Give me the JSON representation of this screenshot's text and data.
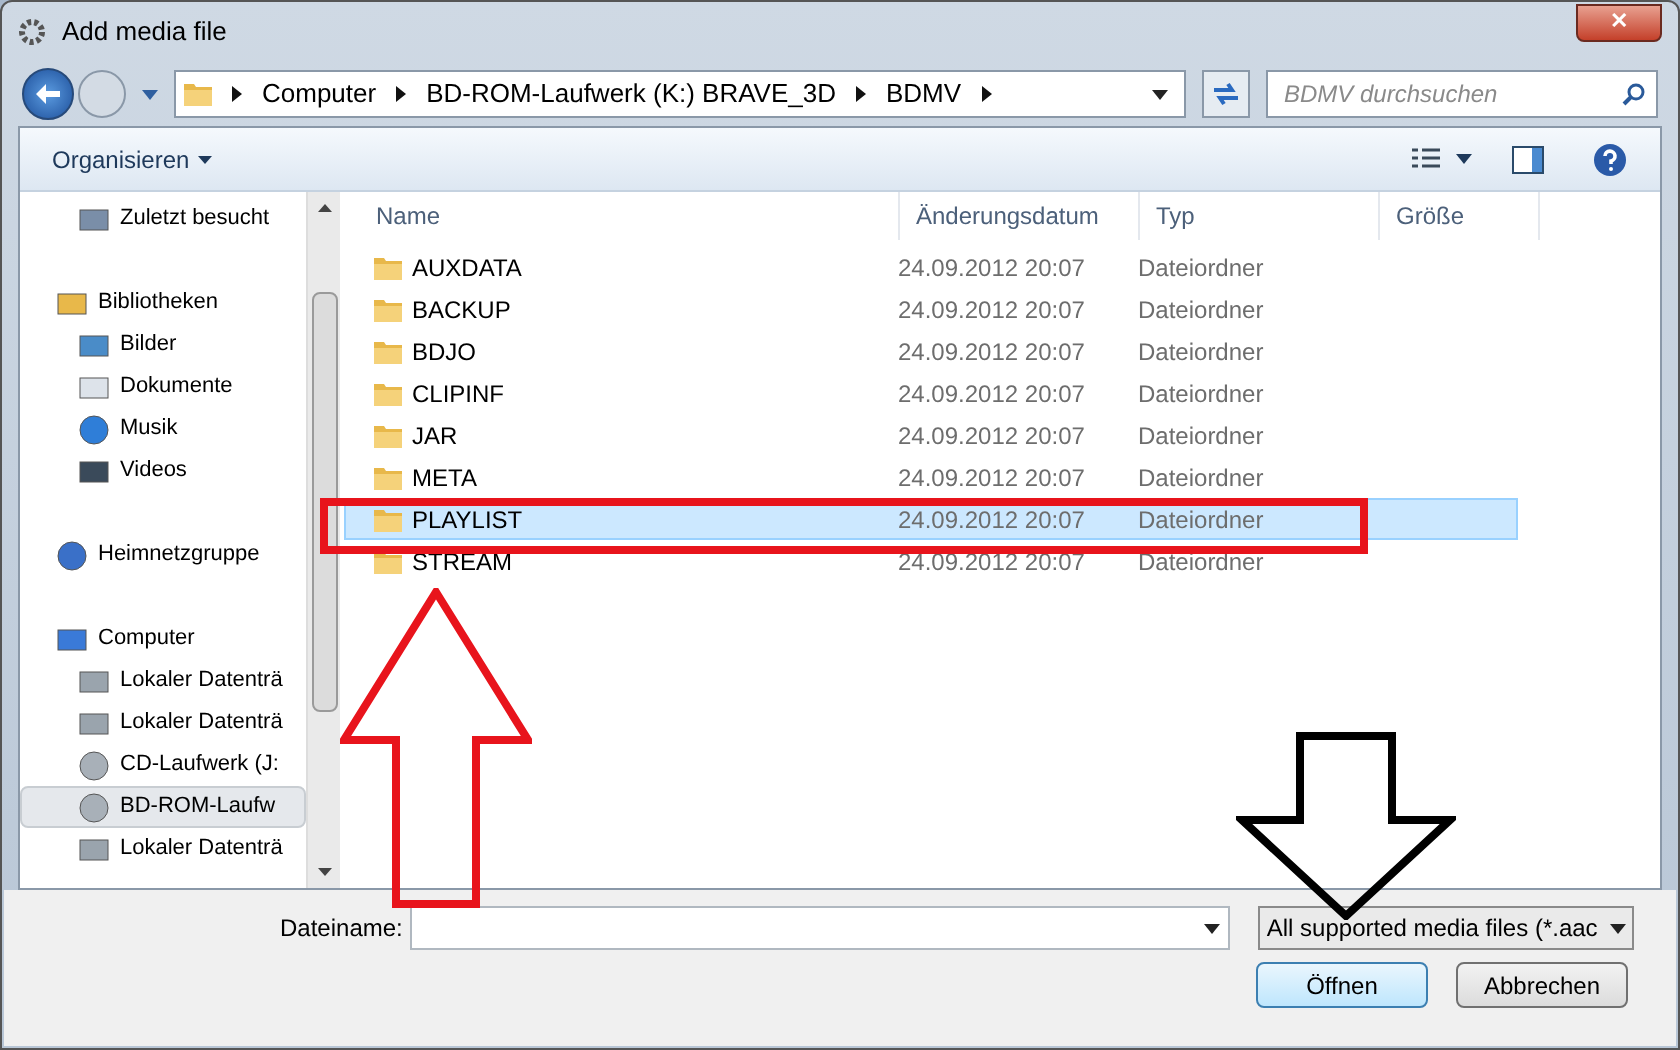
{
  "window": {
    "title": "Add media file",
    "close": "✕"
  },
  "address": {
    "crumbs": [
      "Computer",
      "BD-ROM-Laufwerk (K:) BRAVE_3D",
      "BDMV"
    ],
    "search_placeholder": "BDMV durchsuchen"
  },
  "toolbar": {
    "organize": "Organisieren"
  },
  "sidebar": {
    "groups": [
      {
        "children": [
          {
            "label": "Zuletzt besucht",
            "kind": "recent",
            "selected": false
          }
        ]
      },
      {
        "label": "Bibliotheken",
        "kind": "library",
        "selected": false,
        "children": [
          {
            "label": "Bilder",
            "kind": "pictures",
            "selected": false
          },
          {
            "label": "Dokumente",
            "kind": "documents",
            "selected": false
          },
          {
            "label": "Musik",
            "kind": "music",
            "selected": false
          },
          {
            "label": "Videos",
            "kind": "videos",
            "selected": false
          }
        ]
      },
      {
        "label": "Heimnetzgruppe",
        "kind": "network",
        "selected": false
      },
      {
        "label": "Computer",
        "kind": "computer",
        "selected": false,
        "children": [
          {
            "label": "Lokaler Datenträ",
            "kind": "drive",
            "selected": false
          },
          {
            "label": "Lokaler Datenträ",
            "kind": "drive",
            "selected": false
          },
          {
            "label": "CD-Laufwerk (J:",
            "kind": "cd",
            "selected": false
          },
          {
            "label": "BD-ROM-Laufw",
            "kind": "cd",
            "selected": true
          },
          {
            "label": "Lokaler Datenträ",
            "kind": "drive",
            "selected": false
          }
        ]
      }
    ]
  },
  "table": {
    "columns": [
      "Name",
      "Änderungsdatum",
      "Typ",
      "Größe"
    ],
    "rows": [
      {
        "name": "AUXDATA",
        "date": "24.09.2012 20:07",
        "type": "Dateiordner",
        "selected": false
      },
      {
        "name": "BACKUP",
        "date": "24.09.2012 20:07",
        "type": "Dateiordner",
        "selected": false
      },
      {
        "name": "BDJO",
        "date": "24.09.2012 20:07",
        "type": "Dateiordner",
        "selected": false
      },
      {
        "name": "CLIPINF",
        "date": "24.09.2012 20:07",
        "type": "Dateiordner",
        "selected": false
      },
      {
        "name": "JAR",
        "date": "24.09.2012 20:07",
        "type": "Dateiordner",
        "selected": false
      },
      {
        "name": "META",
        "date": "24.09.2012 20:07",
        "type": "Dateiordner",
        "selected": false
      },
      {
        "name": "PLAYLIST",
        "date": "24.09.2012 20:07",
        "type": "Dateiordner",
        "selected": true
      },
      {
        "name": "STREAM",
        "date": "24.09.2012 20:07",
        "type": "Dateiordner",
        "selected": false
      }
    ]
  },
  "footer": {
    "filename_label": "Dateiname:",
    "filter": "All supported media files (*.aac",
    "open": "Öffnen",
    "cancel": "Abbrechen"
  }
}
